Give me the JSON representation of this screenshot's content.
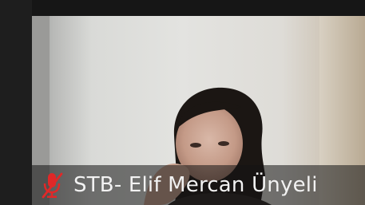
{
  "participant": {
    "name": "STB- Elif Mercan Ünyeli",
    "mic_status": "muted"
  },
  "icons": {
    "mic": "microphone-muted-icon"
  },
  "colors": {
    "mute_red": "#e02828",
    "label_text": "#f2f2f2",
    "overlay_bg": "#141414"
  }
}
